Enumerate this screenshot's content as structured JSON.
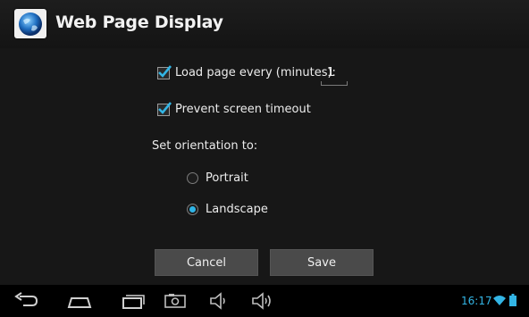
{
  "app": {
    "title": "Web Page Display",
    "icon": "globe-icon"
  },
  "settings": {
    "load_page_label": "Load page every (minutes):",
    "load_page_checked": true,
    "minutes_value": "1",
    "prevent_timeout_label": "Prevent screen timeout",
    "prevent_timeout_checked": true,
    "orientation_label": "Set orientation to:",
    "orientation_options": [
      {
        "label": "Portrait",
        "selected": false
      },
      {
        "label": "Landscape",
        "selected": true
      }
    ]
  },
  "buttons": {
    "cancel": "Cancel",
    "save": "Save"
  },
  "status": {
    "time": "16:17",
    "accent": "#33b5e5"
  },
  "nav": [
    "back-icon",
    "home-icon",
    "recent-apps-icon",
    "screenshot-icon",
    "volume-down-icon",
    "volume-up-icon"
  ]
}
